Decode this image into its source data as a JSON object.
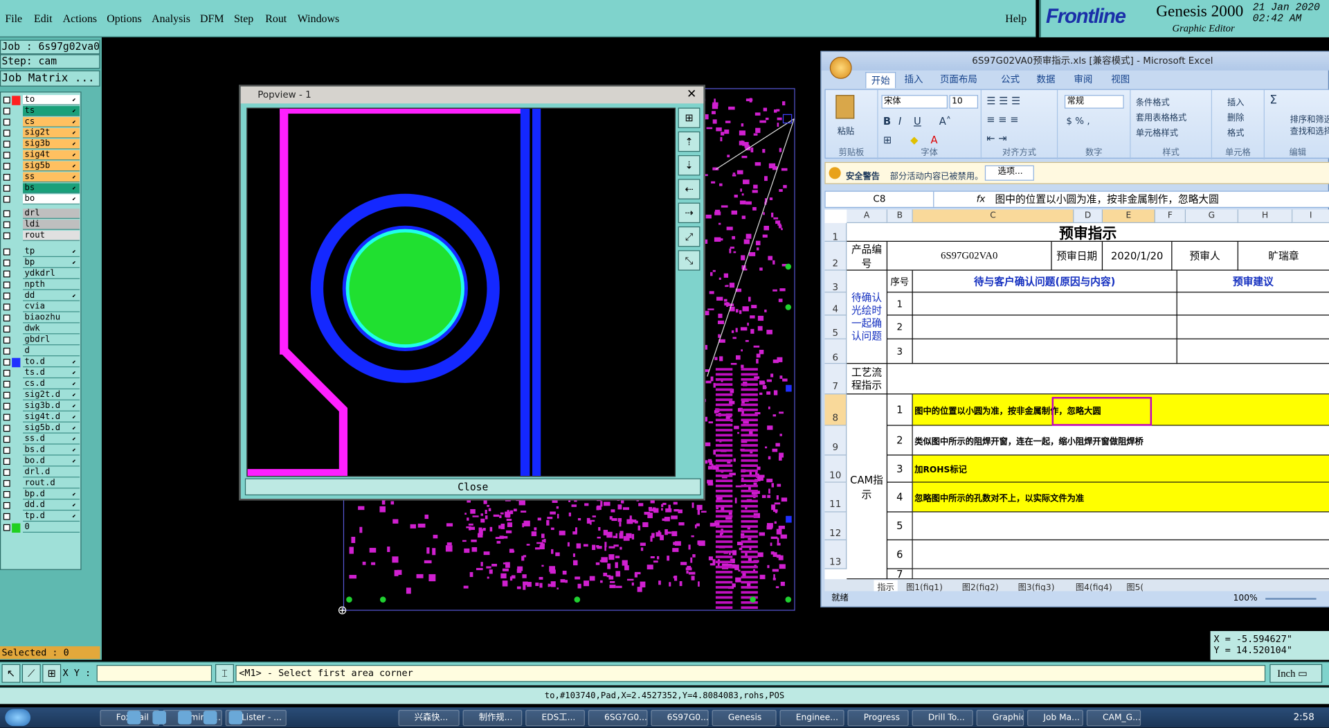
{
  "menu": {
    "items": [
      "File",
      "Edit",
      "Actions",
      "Options",
      "Analysis",
      "DFM",
      "Step",
      "Rout",
      "Windows"
    ],
    "help": "Help"
  },
  "logo": {
    "brand": "Frontline",
    "product": "Genesis 2000",
    "subtitle": "Graphic Editor",
    "date": "21 Jan 2020",
    "time": "02:42 AM"
  },
  "left": {
    "job": "Job : 6s97g02va0",
    "step": "Step: cam",
    "job_matrix": "Job Matrix ...",
    "selected": "Selected : 0"
  },
  "layers": [
    {
      "name": "to",
      "color": "#ff2020",
      "hl": "#ffffff",
      "arrow": "⬋"
    },
    {
      "name": "ts",
      "color": "",
      "hl": "#1aa07a",
      "arrow": "⬋"
    },
    {
      "name": "cs",
      "color": "",
      "hl": "#ffc060",
      "arrow": "⬋"
    },
    {
      "name": "sig2t",
      "color": "",
      "hl": "#ffc060",
      "arrow": "⬋"
    },
    {
      "name": "sig3b",
      "color": "",
      "hl": "#ffc060",
      "arrow": "⬋"
    },
    {
      "name": "sig4t",
      "color": "",
      "hl": "#ffc060",
      "arrow": "⬋"
    },
    {
      "name": "sig5b",
      "color": "",
      "hl": "#ffc060",
      "arrow": "⬋"
    },
    {
      "name": "ss",
      "color": "",
      "hl": "#ffc060",
      "arrow": "⬋"
    },
    {
      "name": "bs",
      "color": "",
      "hl": "#1aa07a",
      "arrow": "⬋"
    },
    {
      "name": "bo",
      "color": "",
      "hl": "#ffffff",
      "arrow": "⬋"
    },
    {
      "name": "drl",
      "color": "",
      "hl": "#bfbfbf",
      "arrow": ""
    },
    {
      "name": "ldi",
      "color": "",
      "hl": "#bfbfbf",
      "arrow": ""
    },
    {
      "name": "rout",
      "color": "",
      "hl": "#e0e0e0",
      "arrow": ""
    },
    {
      "name": "tp",
      "color": "",
      "hl": "",
      "arrow": "⬋"
    },
    {
      "name": "bp",
      "color": "",
      "hl": "",
      "arrow": "⬋"
    },
    {
      "name": "ydkdrl",
      "color": "",
      "hl": "",
      "arrow": ""
    },
    {
      "name": "npth",
      "color": "",
      "hl": "",
      "arrow": ""
    },
    {
      "name": "dd",
      "color": "",
      "hl": "",
      "arrow": "⬋"
    },
    {
      "name": "cvia",
      "color": "",
      "hl": "",
      "arrow": ""
    },
    {
      "name": "biaozhu",
      "color": "",
      "hl": "",
      "arrow": ""
    },
    {
      "name": "dwk",
      "color": "",
      "hl": "",
      "arrow": ""
    },
    {
      "name": "gbdrl",
      "color": "",
      "hl": "",
      "arrow": ""
    },
    {
      "name": "d",
      "color": "",
      "hl": "",
      "arrow": ""
    },
    {
      "name": "to.d",
      "color": "#2030ff",
      "hl": "",
      "arrow": "⬋"
    },
    {
      "name": "ts.d",
      "color": "",
      "hl": "",
      "arrow": "⬋"
    },
    {
      "name": "cs.d",
      "color": "",
      "hl": "",
      "arrow": "⬋"
    },
    {
      "name": "sig2t.d",
      "color": "",
      "hl": "",
      "arrow": "⬋"
    },
    {
      "name": "sig3b.d",
      "color": "",
      "hl": "",
      "arrow": "⬋"
    },
    {
      "name": "sig4t.d",
      "color": "",
      "hl": "",
      "arrow": "⬋"
    },
    {
      "name": "sig5b.d",
      "color": "",
      "hl": "",
      "arrow": "⬋"
    },
    {
      "name": "ss.d",
      "color": "",
      "hl": "",
      "arrow": "⬋"
    },
    {
      "name": "bs.d",
      "color": "",
      "hl": "",
      "arrow": "⬋"
    },
    {
      "name": "bo.d",
      "color": "",
      "hl": "",
      "arrow": "⬋"
    },
    {
      "name": "drl.d",
      "color": "",
      "hl": "",
      "arrow": ""
    },
    {
      "name": "rout.d",
      "color": "",
      "hl": "",
      "arrow": ""
    },
    {
      "name": "bp.d",
      "color": "",
      "hl": "",
      "arrow": "⬋"
    },
    {
      "name": "dd.d",
      "color": "",
      "hl": "",
      "arrow": "⬋"
    },
    {
      "name": "tp.d",
      "color": "",
      "hl": "",
      "arrow": "⬋"
    },
    {
      "name": "0",
      "color": "#20d020",
      "hl": "",
      "arrow": ""
    }
  ],
  "popview": {
    "title": "Popview - 1",
    "close_label": "Close"
  },
  "excel": {
    "title": "6S97G02VA0预审指示.xls  [兼容模式]  - Microsoft Excel",
    "tabs": [
      "开始",
      "插入",
      "页面布局",
      "公式",
      "数据",
      "审阅",
      "视图"
    ],
    "groups": [
      "剪贴板",
      "字体",
      "对齐方式",
      "数字",
      "样式",
      "单元格",
      "编辑"
    ],
    "paste": "粘贴",
    "font_name": "宋体",
    "font_size": "10",
    "number_format": "常规",
    "styles": [
      "条件格式",
      "套用表格格式",
      "单元格样式"
    ],
    "cells_btns": [
      "插入",
      "删除",
      "格式"
    ],
    "edit_btns": [
      "排序和筛选",
      "查找和选择"
    ],
    "security": {
      "title": "安全警告",
      "text": "部分活动内容已被禁用。",
      "button": "选项..."
    },
    "namebox": "C8",
    "formula": "图中的位置以小圆为准，按非金属制作，忽略大圆",
    "cols": [
      "A",
      "B",
      "C",
      "D",
      "E",
      "F",
      "G",
      "H",
      "I"
    ],
    "rows": [
      "1",
      "2",
      "3",
      "4",
      "5",
      "6",
      "7",
      "8",
      "9",
      "10",
      "11",
      "12",
      "13"
    ],
    "sheet": {
      "title": "预审指示",
      "product_label": "产品编号",
      "product_no": "6S97G02VA0",
      "date_label": "预审日期",
      "date": "2020/1/20",
      "reviewer_label": "预审人",
      "reviewer": "旷瑞章",
      "seq": "序号",
      "confirm": "待与客户确认问题(原因与内容)",
      "advice": "预审建议",
      "pending": "待确认光绘时一起确认问题",
      "process": "工艺流程指示",
      "cam": "CAM指示",
      "items": [
        "图中的位置以小圆为准，按非金属制作，忽略大圆",
        "类似图中所示的阻焊开窗，连在一起，缩小阻焊开窗做阻焊桥",
        "加ROHS标记",
        "忽略图中所示的孔数对不上，以实际文件为准"
      ]
    },
    "sheettabs": [
      "指示",
      "图1(fig1)",
      "图2(fig2)",
      "图3(fig3)",
      "图4(fig4)",
      "图5("
    ],
    "status": "就绪",
    "zoom": "100%"
  },
  "coords": {
    "x": "X = -5.594627\"",
    "y": "Y = 14.520104\""
  },
  "cmd": {
    "xy_label": "X Y :",
    "prompt": "<M1> - Select first area corner",
    "units": "Inch"
  },
  "infoline": "to,#103740,Pad,X=2.4527352,Y=4.8084083,rohs,POS",
  "taskbar": {
    "items": [
      "Foxmail",
      "Adminis...",
      "Lister - ...",
      "",
      "",
      "",
      "",
      "",
      "兴森快...",
      "制作规...",
      "EDS工...",
      "6SG7G0...",
      "6S97G0...",
      "Genesis",
      "Enginee...",
      "Progress",
      "Drill To...",
      "Graphic...",
      "Job Ma...",
      "CAM_G..."
    ],
    "clock": "2:58"
  }
}
